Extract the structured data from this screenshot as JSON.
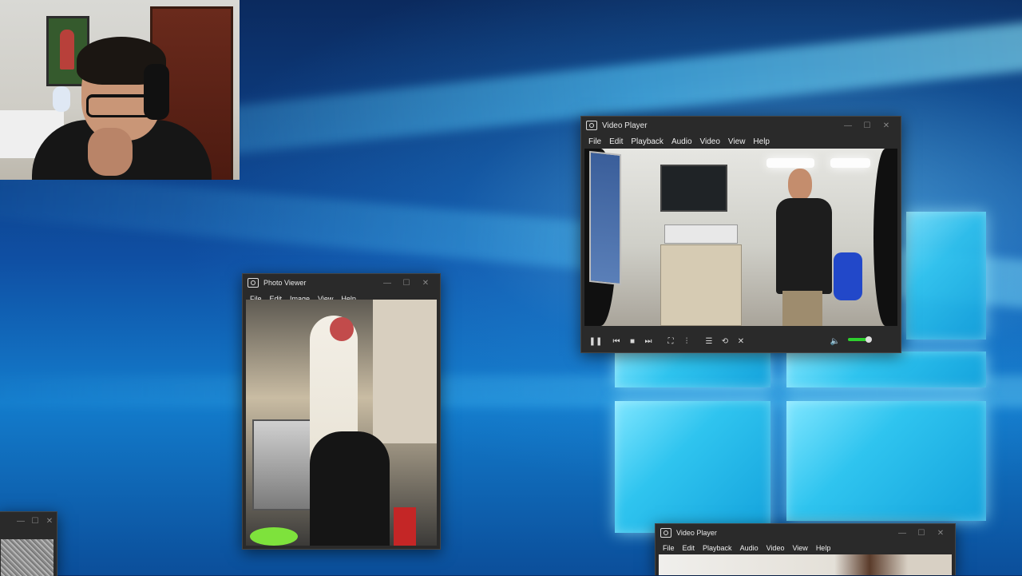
{
  "video_player_main": {
    "title": "Video Player",
    "menu": [
      "File",
      "Edit",
      "Playback",
      "Audio",
      "Video",
      "View",
      "Help"
    ]
  },
  "photo_viewer": {
    "title": "Photo Viewer",
    "menu": [
      "File",
      "Edit",
      "Image",
      "View",
      "Help"
    ]
  },
  "video_player_small": {
    "title": "Video Player",
    "menu": [
      "File",
      "Edit",
      "Playback",
      "Audio",
      "Video",
      "View",
      "Help"
    ]
  },
  "colors": {
    "volume_level": "#2ed12e",
    "window_bg": "#2a2a2a"
  },
  "icons": {
    "transport": [
      "pause-icon",
      "previous-icon",
      "stop-icon",
      "next-icon",
      "fullscreen-icon",
      "equalizer-icon",
      "playlist-icon",
      "loop-icon",
      "shuffle-icon",
      "volume-icon"
    ]
  }
}
